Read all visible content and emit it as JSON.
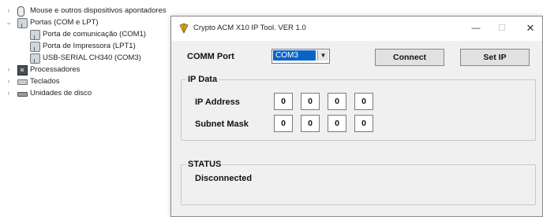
{
  "device_tree": [
    {
      "label": "Mouse e outros dispositivos apontadores",
      "expanded": false,
      "icon": "mouse-icon"
    },
    {
      "label": "Portas (COM e LPT)",
      "expanded": true,
      "icon": "port-icon"
    },
    {
      "label": "Porta de comunicação (COM1)",
      "child": true,
      "icon": "port-icon"
    },
    {
      "label": "Porta de Impressora (LPT1)",
      "child": true,
      "icon": "port-icon"
    },
    {
      "label": "USB-SERIAL CH340 (COM3)",
      "child": true,
      "icon": "port-icon"
    },
    {
      "label": "Processadores",
      "expanded": false,
      "icon": "processor-icon"
    },
    {
      "label": "Teclados",
      "expanded": false,
      "icon": "keyboard-icon"
    },
    {
      "label": "Unidades de disco",
      "expanded": false,
      "icon": "disk-icon"
    }
  ],
  "window": {
    "title": "Crypto ACM X10 IP Tool. VER 1.0",
    "icon": "crypto-app-icon",
    "controls": {
      "minimize": "—",
      "maximize": "☐",
      "close": "✕"
    }
  },
  "comm": {
    "label": "COMM Port",
    "selected": "COM3",
    "dropdown_arrow": "▼"
  },
  "buttons": {
    "connect": "Connect",
    "set_ip": "Set IP"
  },
  "ip_data": {
    "group_title": "IP Data",
    "ip_label": "IP Address",
    "ip": [
      "0",
      "0",
      "0",
      "0"
    ],
    "mask_label": "Subnet Mask",
    "mask": [
      "0",
      "0",
      "0",
      "0"
    ]
  },
  "status": {
    "group_title": "STATUS",
    "text": "Disconnected"
  },
  "colors": {
    "selection": "#0a64c8",
    "app_icon_accent": "#d9a21b"
  }
}
